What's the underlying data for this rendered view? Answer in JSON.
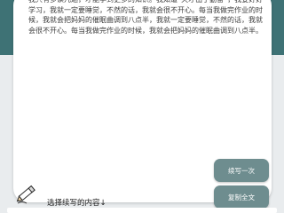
{
  "essay": {
    "text": "我只有多读几遍，才能学到更多的知识。我知道“天才出于勤奋”，我要好好学习，我就一定要睡觉，不然的话，我就会很不开心。每当我做完作业的时候，我就会把妈妈的催眠曲调到八点半，我就一定要睡觉，不然的话，我就会很不开心。每当我做完作业的时候，我就会把妈妈的催眠曲调到八点半。"
  },
  "buttons": {
    "continue_label": "续写一次",
    "copy_label": "复制全文"
  },
  "footer": {
    "select_label": "选择续写的内容↓"
  },
  "icons": {
    "pen": "pencil-icon"
  },
  "colors": {
    "header_teal": "#3e7275",
    "button_gray_teal": "#6e8d8f",
    "card_white": "#ffffff",
    "page_bg": "#e9ecee"
  }
}
